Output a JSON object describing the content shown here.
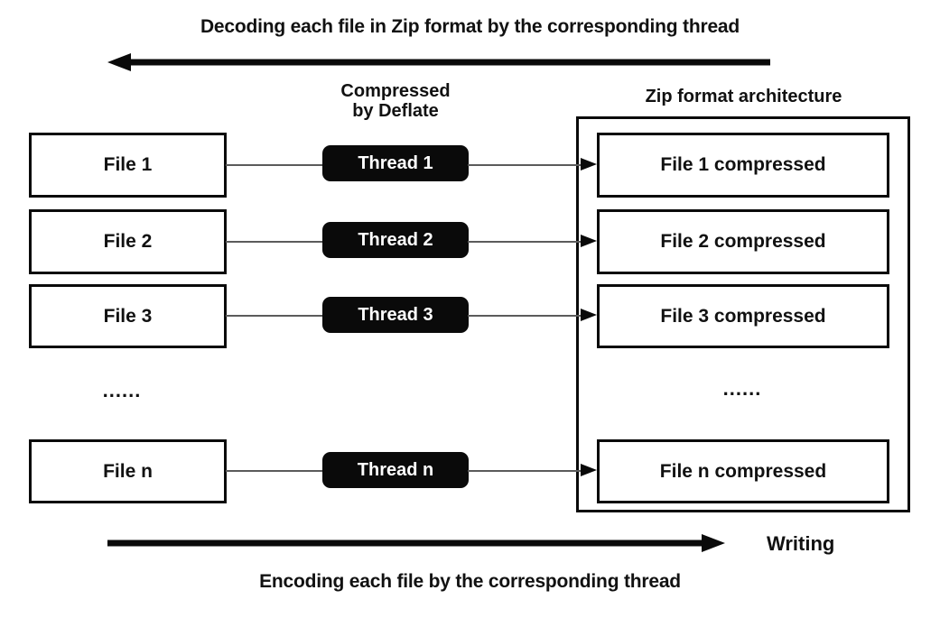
{
  "diagram": {
    "top_caption": "Decoding each file in Zip format by the corresponding thread",
    "bottom_caption": "Encoding each file by the corresponding thread",
    "writing_label": "Writing",
    "compressed_label_line1": "Compressed",
    "compressed_label_line2": "by Deflate",
    "zip_architecture_label": "Zip format architecture",
    "left_ellipsis": "......",
    "right_ellipsis": "......",
    "colors": {
      "stroke": "#0a0a0a",
      "thread_fill": "#0a0a0a",
      "thread_text": "#ffffff",
      "connector": "#5b5b5b",
      "background": "#ffffff",
      "text": "#111111"
    },
    "rows": [
      {
        "file": "File 1",
        "thread": "Thread 1",
        "compressed": "File 1 compressed"
      },
      {
        "file": "File 2",
        "thread": "Thread 2",
        "compressed": "File 2 compressed"
      },
      {
        "file": "File 3",
        "thread": "Thread 3",
        "compressed": "File 3 compressed"
      },
      {
        "file": "File n",
        "thread": "Thread n",
        "compressed": "File n compressed"
      }
    ]
  }
}
